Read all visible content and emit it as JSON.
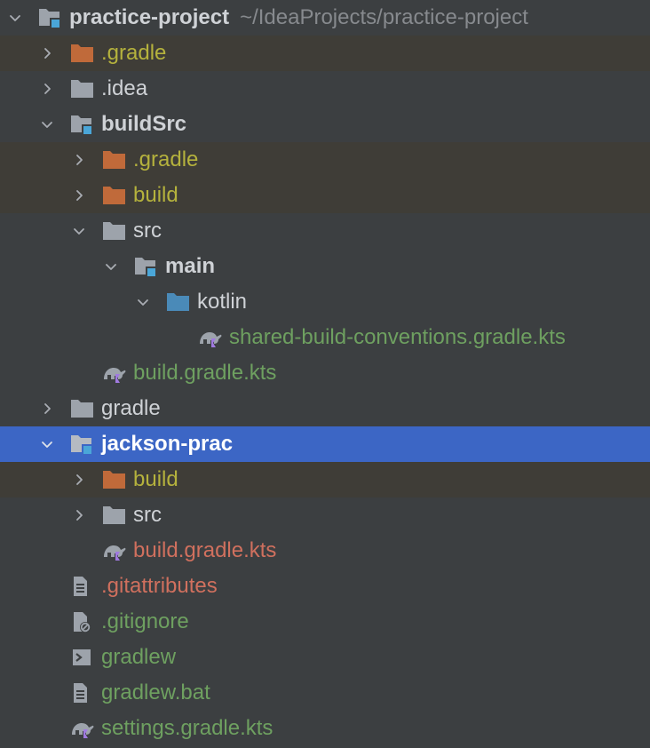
{
  "tree": {
    "root": {
      "name": "practice-project",
      "path": "~/IdeaProjects/practice-project"
    },
    "items": [
      {
        "label": ".gradle"
      },
      {
        "label": ".idea"
      },
      {
        "label": "buildSrc"
      },
      {
        "label": ".gradle"
      },
      {
        "label": "build"
      },
      {
        "label": "src"
      },
      {
        "label": "main"
      },
      {
        "label": "kotlin"
      },
      {
        "label": "shared-build-conventions.gradle.kts"
      },
      {
        "label": "build.gradle.kts"
      },
      {
        "label": "gradle"
      },
      {
        "label": "jackson-prac"
      },
      {
        "label": "build"
      },
      {
        "label": "src"
      },
      {
        "label": "build.gradle.kts"
      },
      {
        "label": ".gitattributes"
      },
      {
        "label": ".gitignore"
      },
      {
        "label": "gradlew"
      },
      {
        "label": "gradlew.bat"
      },
      {
        "label": "settings.gradle.kts"
      }
    ]
  },
  "colors": {
    "background": "#3c3f41",
    "excluded_row": "#3f3d37",
    "selection": "#3c66c5",
    "excluded_text": "#b5b23d",
    "added_text": "#6ea060",
    "modified_text": "#d0705e",
    "excluded_folder": "#c06a3a",
    "folder": "#9da3ab",
    "source_folder": "#4a8ab8",
    "module_marker": "#4aa6d8",
    "kotlin_marker": "#a07ae0"
  },
  "icons": {
    "chevron_expanded": "chevron-down-icon",
    "chevron_collapsed": "chevron-right-icon",
    "module": "module-folder-icon",
    "folder": "folder-icon",
    "excluded_folder": "excluded-folder-icon",
    "source_folder": "source-root-folder-icon",
    "gradle_kts": "gradle-kotlin-script-icon",
    "text_file": "text-file-icon",
    "ignore_file": "ignore-file-icon",
    "shell_script": "shell-script-icon"
  }
}
